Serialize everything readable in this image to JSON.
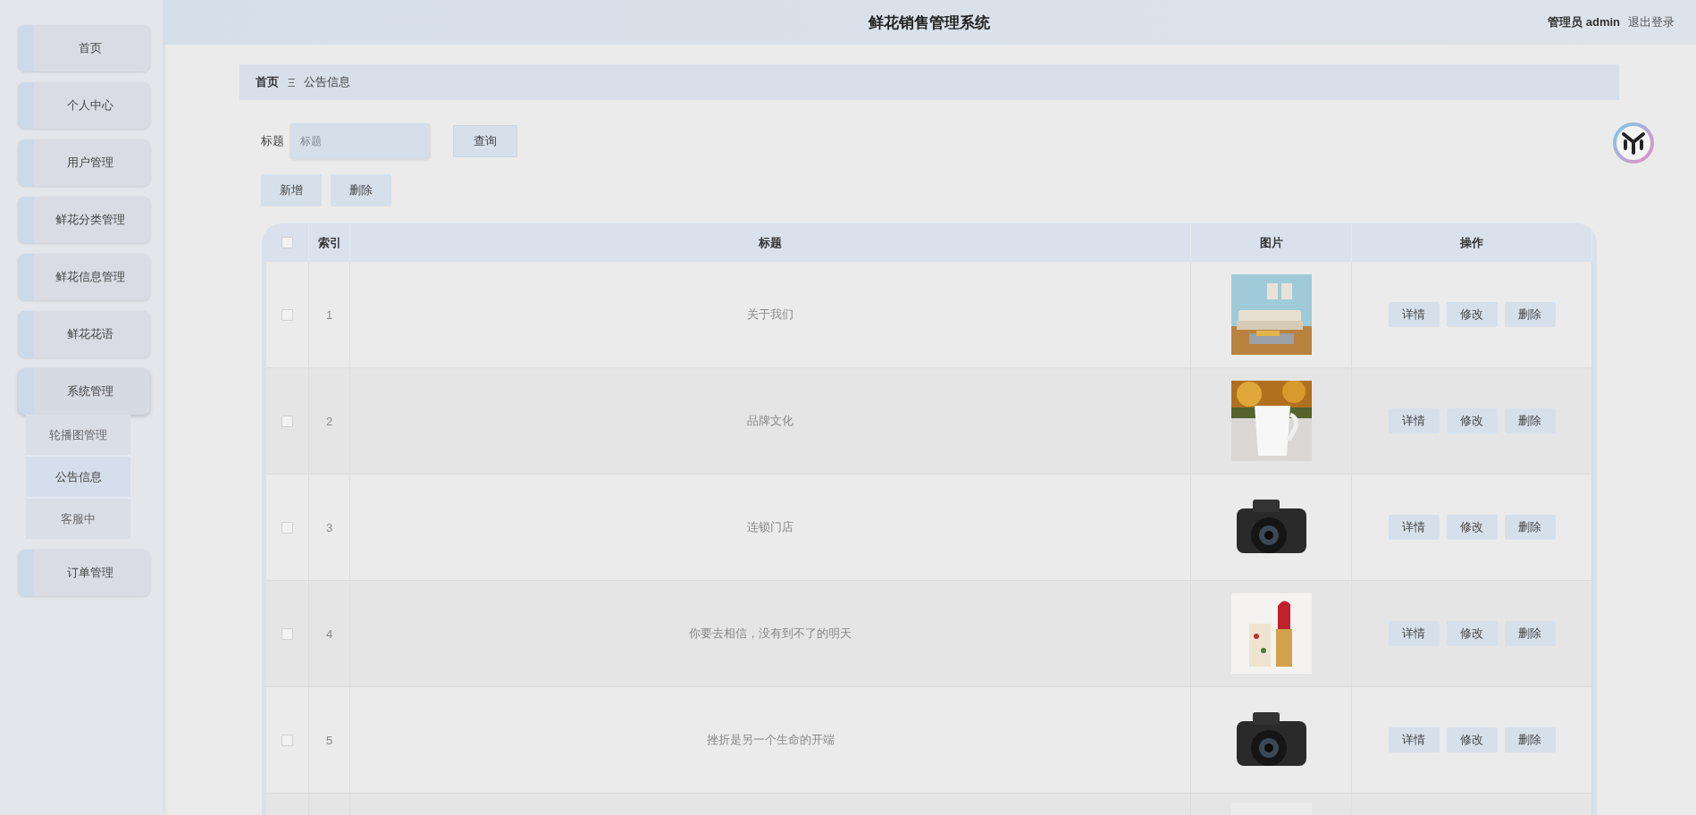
{
  "header": {
    "title": "鲜花销售管理系统",
    "user_label": "管理员 admin",
    "logout": "退出登录"
  },
  "sidebar": {
    "items": [
      {
        "label": "首页"
      },
      {
        "label": "个人中心"
      },
      {
        "label": "用户管理"
      },
      {
        "label": "鲜花分类管理"
      },
      {
        "label": "鲜花信息管理"
      },
      {
        "label": "鲜花花语"
      },
      {
        "label": "系统管理",
        "expanded": true,
        "children": [
          {
            "label": "轮播图管理",
            "selected": false
          },
          {
            "label": "公告信息",
            "selected": true
          },
          {
            "label": "客服中",
            "selected": false
          }
        ]
      },
      {
        "label": "订单管理"
      }
    ]
  },
  "breadcrumb": {
    "home": "首页",
    "separator": "Ξ",
    "current": "公告信息"
  },
  "search": {
    "label": "标题",
    "placeholder": "标题",
    "button": "查询"
  },
  "toolbar": {
    "buttons": [
      "新增",
      "删除"
    ]
  },
  "table": {
    "all_checked": false,
    "columns": [
      "索引",
      "标题",
      "图片",
      "操作"
    ],
    "rows": [
      {
        "checked": false,
        "index": "1",
        "title": "关于我们",
        "image": {
          "kind": "picture"
        },
        "actions": [
          "详情",
          "修改",
          "删除"
        ]
      },
      {
        "checked": false,
        "index": "2",
        "title": "品牌文化",
        "image": {
          "kind": "picture"
        },
        "actions": [
          "详情",
          "修改",
          "删除"
        ]
      },
      {
        "checked": false,
        "index": "3",
        "title": "连锁门店",
        "image": {
          "kind": "picture"
        },
        "actions": [
          "详情",
          "修改",
          "删除"
        ]
      },
      {
        "checked": false,
        "index": "4",
        "title": "你要去相信，没有到不了的明天",
        "image": {
          "kind": "picture"
        },
        "actions": [
          "详情",
          "修改",
          "删除"
        ]
      },
      {
        "checked": false,
        "index": "5",
        "title": "挫折是另一个生命的开端",
        "image": {
          "kind": "picture"
        },
        "actions": [
          "详情",
          "修改",
          "删除"
        ]
      },
      {
        "image": {
          "kind": "picture"
        }
      }
    ]
  }
}
